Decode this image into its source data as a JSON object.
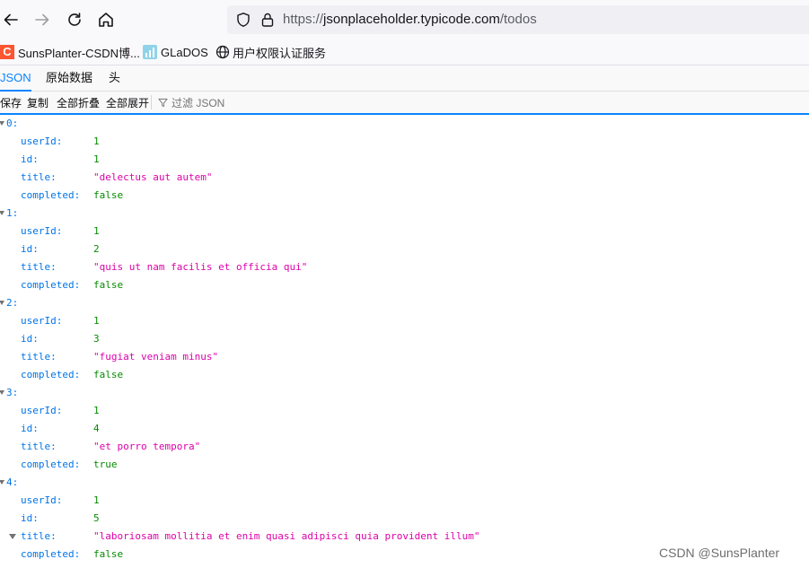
{
  "browser": {
    "url_prefix": "https://",
    "url_host_lead": "jsonplaceholder.",
    "url_host": "typicode.com",
    "url_path": "/todos"
  },
  "bookmarks": [
    {
      "icon": "csdn-logo-icon",
      "label": "SunsPlanter-CSDN博..."
    },
    {
      "icon": "glados-icon",
      "label": "GLaDOS"
    },
    {
      "icon": "globe-icon",
      "label": "用户权限认证服务"
    }
  ],
  "viewer": {
    "tabs": [
      "JSON",
      "原始数据",
      "头"
    ],
    "active_tab": "JSON",
    "toolbar": {
      "save": "保存",
      "copy": "复制",
      "collapse_all": "全部折叠",
      "expand_all": "全部展开",
      "filter_placeholder": "过滤 JSON"
    }
  },
  "colors": {
    "accent": "#0a84ff",
    "key": "#0074e8",
    "string": "#dd00a9",
    "number": "#058b00"
  },
  "todos": [
    {
      "index": "0:",
      "fields": [
        {
          "key": "userId:",
          "value": "1",
          "type": "num"
        },
        {
          "key": "id:",
          "value": "1",
          "type": "num"
        },
        {
          "key": "title:",
          "value": "\"delectus aut autem\"",
          "type": "str"
        },
        {
          "key": "completed:",
          "value": "false",
          "type": "bool"
        }
      ]
    },
    {
      "index": "1:",
      "fields": [
        {
          "key": "userId:",
          "value": "1",
          "type": "num"
        },
        {
          "key": "id:",
          "value": "2",
          "type": "num"
        },
        {
          "key": "title:",
          "value": "\"quis ut nam facilis et officia qui\"",
          "type": "str"
        },
        {
          "key": "completed:",
          "value": "false",
          "type": "bool"
        }
      ]
    },
    {
      "index": "2:",
      "fields": [
        {
          "key": "userId:",
          "value": "1",
          "type": "num"
        },
        {
          "key": "id:",
          "value": "3",
          "type": "num"
        },
        {
          "key": "title:",
          "value": "\"fugiat veniam minus\"",
          "type": "str"
        },
        {
          "key": "completed:",
          "value": "false",
          "type": "bool"
        }
      ]
    },
    {
      "index": "3:",
      "fields": [
        {
          "key": "userId:",
          "value": "1",
          "type": "num"
        },
        {
          "key": "id:",
          "value": "4",
          "type": "num"
        },
        {
          "key": "title:",
          "value": "\"et porro tempora\"",
          "type": "str"
        },
        {
          "key": "completed:",
          "value": "true",
          "type": "bool"
        }
      ]
    },
    {
      "index": "4:",
      "fields": [
        {
          "key": "userId:",
          "value": "1",
          "type": "num"
        },
        {
          "key": "id:",
          "value": "5",
          "type": "num"
        },
        {
          "key": "title:",
          "value": "\"laboriosam mollitia et enim quasi adipisci quia provident illum\"",
          "type": "str",
          "hover": true
        },
        {
          "key": "completed:",
          "value": "false",
          "type": "bool"
        }
      ]
    }
  ],
  "watermark": "CSDN @SunsPlanter"
}
